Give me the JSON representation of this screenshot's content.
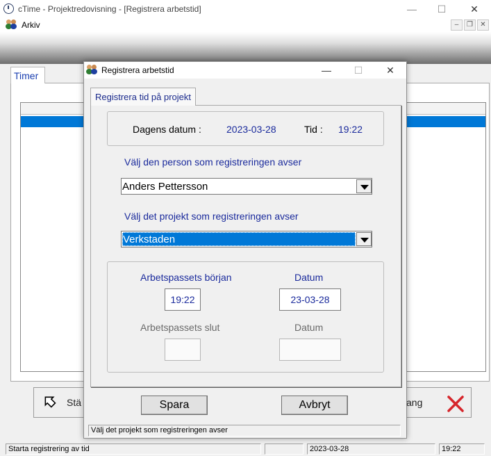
{
  "window": {
    "title": "cTime - Projektredovisning - [Registrera arbetstid]",
    "minimize_glyph": "—",
    "maximize_glyph": "☐",
    "close_glyph": "✕"
  },
  "menu": {
    "items": [
      "Arkiv"
    ],
    "mdi_minimize": "–",
    "mdi_restore": "❐",
    "mdi_close": "✕"
  },
  "main": {
    "tab_label": "Timer",
    "button_left_label": "Stä",
    "button_right_label": "ang"
  },
  "statusbar": {
    "message": "Starta registrering av tid",
    "pane2": "",
    "date": "2023-03-28",
    "time": "19:22"
  },
  "dialog": {
    "title": "Registrera arbetstid",
    "tab_label": "Registrera tid på projekt",
    "date_label": "Dagens datum :",
    "date_value": "2023-03-28",
    "time_label": "Tid :",
    "time_value": "19:22",
    "person_prompt": "Välj den person som registreringen avser",
    "person_selected": "Anders Pettersson",
    "project_prompt": "Välj det projekt som registreringen avser",
    "project_selected": "Verkstaden",
    "start_label": "Arbetspassets början",
    "start_date_label": "Datum",
    "start_time_value": "19:22",
    "start_date_value": "23-03-28",
    "end_label": "Arbetspassets slut",
    "end_date_label": "Datum",
    "end_time_value": "",
    "end_date_value": "",
    "save_label": "Spara",
    "cancel_label": "Avbryt",
    "status_text": "Välj det projekt som registreringen avser"
  },
  "colors": {
    "accent_blue": "#0078d7",
    "label_blue": "#1a2a9c",
    "close_red": "#d6252b"
  }
}
